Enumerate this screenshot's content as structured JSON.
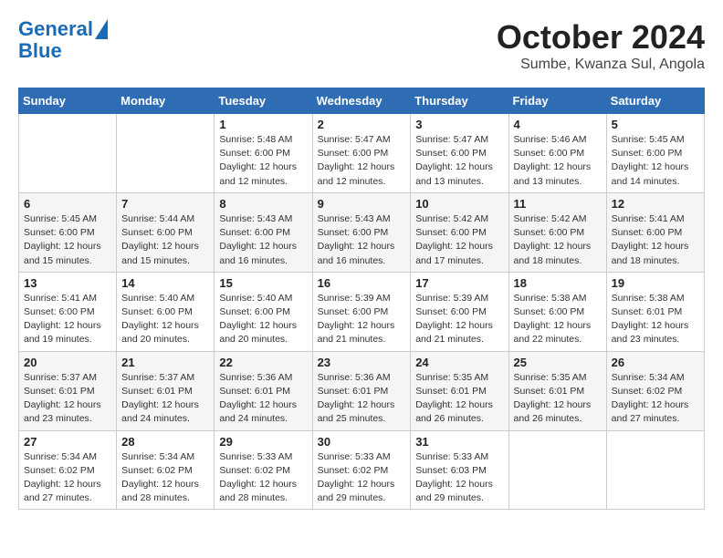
{
  "logo": {
    "line1": "General",
    "line2": "Blue"
  },
  "title": "October 2024",
  "subtitle": "Sumbe, Kwanza Sul, Angola",
  "weekdays": [
    "Sunday",
    "Monday",
    "Tuesday",
    "Wednesday",
    "Thursday",
    "Friday",
    "Saturday"
  ],
  "weeks": [
    [
      {
        "day": "",
        "info": ""
      },
      {
        "day": "",
        "info": ""
      },
      {
        "day": "1",
        "info": "Sunrise: 5:48 AM\nSunset: 6:00 PM\nDaylight: 12 hours and 12 minutes."
      },
      {
        "day": "2",
        "info": "Sunrise: 5:47 AM\nSunset: 6:00 PM\nDaylight: 12 hours and 12 minutes."
      },
      {
        "day": "3",
        "info": "Sunrise: 5:47 AM\nSunset: 6:00 PM\nDaylight: 12 hours and 13 minutes."
      },
      {
        "day": "4",
        "info": "Sunrise: 5:46 AM\nSunset: 6:00 PM\nDaylight: 12 hours and 13 minutes."
      },
      {
        "day": "5",
        "info": "Sunrise: 5:45 AM\nSunset: 6:00 PM\nDaylight: 12 hours and 14 minutes."
      }
    ],
    [
      {
        "day": "6",
        "info": "Sunrise: 5:45 AM\nSunset: 6:00 PM\nDaylight: 12 hours and 15 minutes."
      },
      {
        "day": "7",
        "info": "Sunrise: 5:44 AM\nSunset: 6:00 PM\nDaylight: 12 hours and 15 minutes."
      },
      {
        "day": "8",
        "info": "Sunrise: 5:43 AM\nSunset: 6:00 PM\nDaylight: 12 hours and 16 minutes."
      },
      {
        "day": "9",
        "info": "Sunrise: 5:43 AM\nSunset: 6:00 PM\nDaylight: 12 hours and 16 minutes."
      },
      {
        "day": "10",
        "info": "Sunrise: 5:42 AM\nSunset: 6:00 PM\nDaylight: 12 hours and 17 minutes."
      },
      {
        "day": "11",
        "info": "Sunrise: 5:42 AM\nSunset: 6:00 PM\nDaylight: 12 hours and 18 minutes."
      },
      {
        "day": "12",
        "info": "Sunrise: 5:41 AM\nSunset: 6:00 PM\nDaylight: 12 hours and 18 minutes."
      }
    ],
    [
      {
        "day": "13",
        "info": "Sunrise: 5:41 AM\nSunset: 6:00 PM\nDaylight: 12 hours and 19 minutes."
      },
      {
        "day": "14",
        "info": "Sunrise: 5:40 AM\nSunset: 6:00 PM\nDaylight: 12 hours and 20 minutes."
      },
      {
        "day": "15",
        "info": "Sunrise: 5:40 AM\nSunset: 6:00 PM\nDaylight: 12 hours and 20 minutes."
      },
      {
        "day": "16",
        "info": "Sunrise: 5:39 AM\nSunset: 6:00 PM\nDaylight: 12 hours and 21 minutes."
      },
      {
        "day": "17",
        "info": "Sunrise: 5:39 AM\nSunset: 6:00 PM\nDaylight: 12 hours and 21 minutes."
      },
      {
        "day": "18",
        "info": "Sunrise: 5:38 AM\nSunset: 6:00 PM\nDaylight: 12 hours and 22 minutes."
      },
      {
        "day": "19",
        "info": "Sunrise: 5:38 AM\nSunset: 6:01 PM\nDaylight: 12 hours and 23 minutes."
      }
    ],
    [
      {
        "day": "20",
        "info": "Sunrise: 5:37 AM\nSunset: 6:01 PM\nDaylight: 12 hours and 23 minutes."
      },
      {
        "day": "21",
        "info": "Sunrise: 5:37 AM\nSunset: 6:01 PM\nDaylight: 12 hours and 24 minutes."
      },
      {
        "day": "22",
        "info": "Sunrise: 5:36 AM\nSunset: 6:01 PM\nDaylight: 12 hours and 24 minutes."
      },
      {
        "day": "23",
        "info": "Sunrise: 5:36 AM\nSunset: 6:01 PM\nDaylight: 12 hours and 25 minutes."
      },
      {
        "day": "24",
        "info": "Sunrise: 5:35 AM\nSunset: 6:01 PM\nDaylight: 12 hours and 26 minutes."
      },
      {
        "day": "25",
        "info": "Sunrise: 5:35 AM\nSunset: 6:01 PM\nDaylight: 12 hours and 26 minutes."
      },
      {
        "day": "26",
        "info": "Sunrise: 5:34 AM\nSunset: 6:02 PM\nDaylight: 12 hours and 27 minutes."
      }
    ],
    [
      {
        "day": "27",
        "info": "Sunrise: 5:34 AM\nSunset: 6:02 PM\nDaylight: 12 hours and 27 minutes."
      },
      {
        "day": "28",
        "info": "Sunrise: 5:34 AM\nSunset: 6:02 PM\nDaylight: 12 hours and 28 minutes."
      },
      {
        "day": "29",
        "info": "Sunrise: 5:33 AM\nSunset: 6:02 PM\nDaylight: 12 hours and 28 minutes."
      },
      {
        "day": "30",
        "info": "Sunrise: 5:33 AM\nSunset: 6:02 PM\nDaylight: 12 hours and 29 minutes."
      },
      {
        "day": "31",
        "info": "Sunrise: 5:33 AM\nSunset: 6:03 PM\nDaylight: 12 hours and 29 minutes."
      },
      {
        "day": "",
        "info": ""
      },
      {
        "day": "",
        "info": ""
      }
    ]
  ]
}
